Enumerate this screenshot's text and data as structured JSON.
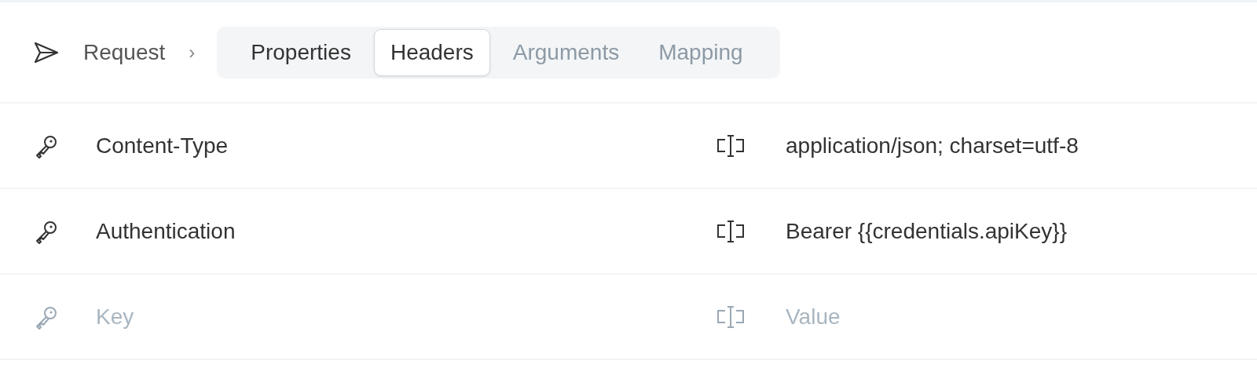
{
  "breadcrumb": {
    "label": "Request",
    "separator": "›"
  },
  "tabs": [
    {
      "label": "Properties",
      "selected": false,
      "disabled": false
    },
    {
      "label": "Headers",
      "selected": true,
      "disabled": false
    },
    {
      "label": "Arguments",
      "selected": false,
      "disabled": true
    },
    {
      "label": "Mapping",
      "selected": false,
      "disabled": true
    }
  ],
  "headers": [
    {
      "key": {
        "value": "Content-Type"
      },
      "value": {
        "value": "application/json; charset=utf-8"
      }
    },
    {
      "key": {
        "value": "Authentication"
      },
      "value": {
        "value": "Bearer {{credentials.apiKey}}"
      }
    },
    {
      "key": {
        "placeholder": "Key"
      },
      "value": {
        "placeholder": "Value"
      }
    }
  ]
}
